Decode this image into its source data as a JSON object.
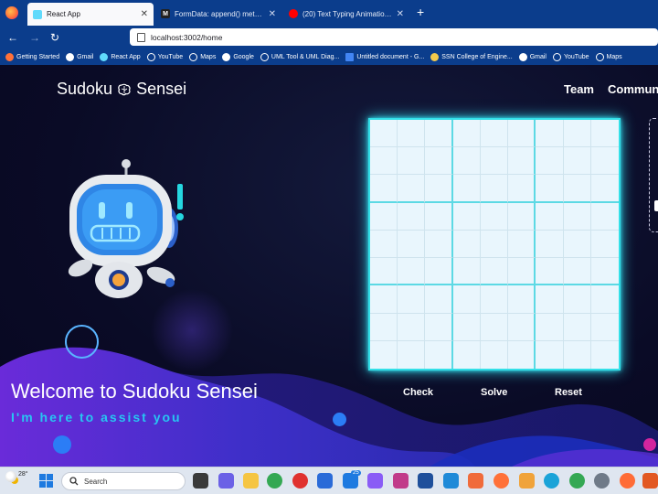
{
  "browser": {
    "tabs": [
      {
        "title": "React App",
        "active": true,
        "fav_color": "#61dafb"
      },
      {
        "title": "FormData: append() method - W",
        "active": false,
        "fav_color": "#222222",
        "fav_glyph": "M"
      },
      {
        "title": "(20) Text Typing Animation On",
        "active": false,
        "fav_color": "#ff0000"
      }
    ],
    "url": "localhost:3002/home",
    "bookmarks": [
      {
        "label": "Getting Started",
        "color": "#ff7139"
      },
      {
        "label": "Gmail",
        "color": "#ffffff"
      },
      {
        "label": "React App",
        "color": "#61dafb"
      },
      {
        "label": "YouTube",
        "color": "#ffffff"
      },
      {
        "label": "Maps",
        "color": "#ffffff"
      },
      {
        "label": "Google",
        "color": "#ffffff"
      },
      {
        "label": "UML Tool & UML Diag...",
        "color": "#ffffff"
      },
      {
        "label": "Untitled document - G...",
        "color": "#4285f4"
      },
      {
        "label": "SSN College of Engine...",
        "color": "#f2c94c"
      },
      {
        "label": "Gmail",
        "color": "#ffffff"
      },
      {
        "label": "YouTube",
        "color": "#ffffff"
      },
      {
        "label": "Maps",
        "color": "#ffffff"
      }
    ]
  },
  "page": {
    "brand": "Sudoku",
    "brand_suffix": "Sensei",
    "menu": [
      "Team",
      "Commun"
    ],
    "hero_title": "Welcome to Sudoku Sensei",
    "hero_subtitle": "I'm here to assist you",
    "actions": [
      "Check",
      "Solve",
      "Reset"
    ],
    "board_size": 9,
    "colors": {
      "accent": "#33e0e8",
      "subtitle": "#27c6f2",
      "board": "#e9f6fd"
    }
  },
  "taskbar": {
    "weather_temp": "28°",
    "search_placeholder": "Search",
    "mail_badge": "25"
  }
}
